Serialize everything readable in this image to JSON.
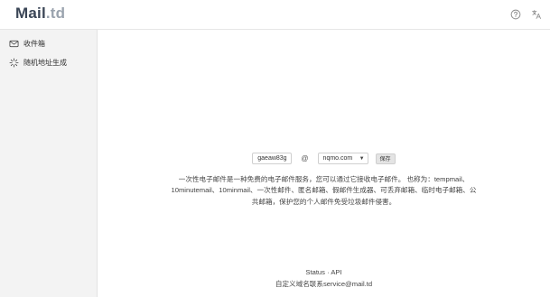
{
  "header": {
    "logo_main": "Mail",
    "logo_suffix": ".td",
    "icons": [
      "help-circle-icon",
      "translate-icon"
    ]
  },
  "sidebar": {
    "items": [
      {
        "label": "收件箱",
        "icon": "mail-icon"
      },
      {
        "label": "随机地址生成",
        "icon": "sparkle-icon"
      }
    ]
  },
  "main": {
    "username_value": "gaeaw83g",
    "at_symbol": "@",
    "domain_value": "nqmo.com",
    "save_label": "保存",
    "description": "一次性电子邮件是一种免费的电子邮件服务，您可以通过它接收电子邮件。 也称为：tempmail、10minutemail、10minmail、一次性邮件、匿名邮箱、假邮件生成器、可丢弃邮箱、临时电子邮箱、公共邮箱，保护您的个人邮件免受垃圾邮件侵害。"
  },
  "footer": {
    "status_link": "Status",
    "separator": "·",
    "api_link": "API",
    "contact": "自定义域名联系service@mail.td"
  }
}
